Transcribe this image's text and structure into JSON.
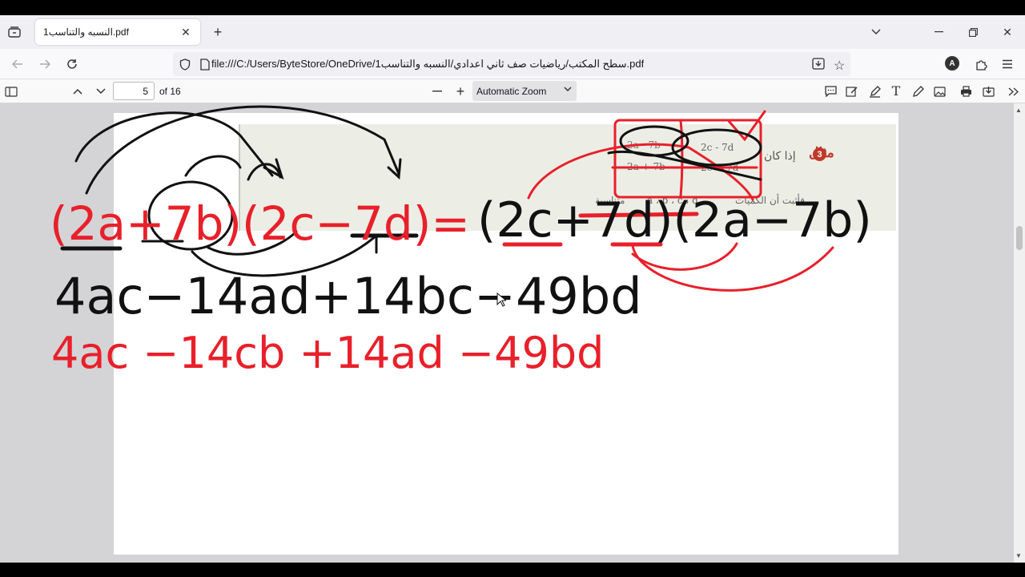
{
  "browser": {
    "tab": {
      "title": "النسبه والتناسب1.pdf"
    },
    "url": "file:///C:/Users/ByteStore/OneDrive/سطح المكتب/رياضيات صف ثاني اعدادي/النسبه والتناسب1.pdf",
    "profile_initial": "A"
  },
  "pdf_toolbar": {
    "page_number": "5",
    "page_count": "of 16",
    "zoom": "Automatic Zoom"
  },
  "document": {
    "example_label": "مثال",
    "example_number": "3",
    "condition_text": "إذا كان",
    "prove_text": "فأثبت أن الكميات",
    "proportional_text": "متناسبة",
    "var_list": "a ، b ، c ، d",
    "fraction_tl_num": "2a - 7b",
    "fraction_tl_den": "2a + 7b",
    "fraction_tr_num": "2c - 7d",
    "fraction_tr_den": "2c + 7d"
  },
  "handwriting": {
    "line1_red_left": "(2a+7b)(2c−7d)=",
    "line1_black_right": "(2c+7d)(2a−7b)",
    "line2_black": "4ac−14ad+14bc−49bd",
    "line3_red": "4ac −14cb +14ad −49bd"
  },
  "colors": {
    "ink_red": "#e8202a",
    "ink_black": "#111111",
    "accent_badge": "#c0392b"
  }
}
